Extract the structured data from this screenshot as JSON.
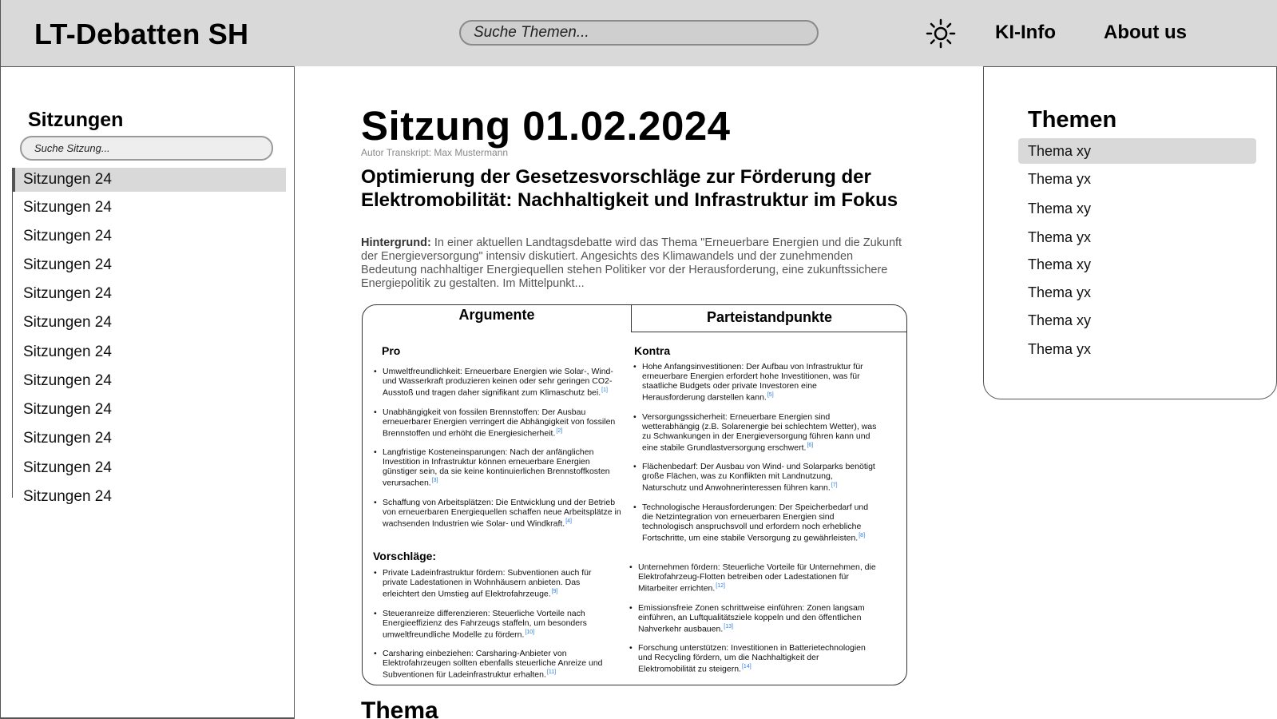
{
  "header": {
    "logo": "LT-Debatten SH",
    "search_placeholder": "Suche Themen...",
    "theme_toggle_icon": "sun-icon",
    "nav": [
      "KI-Info",
      "About us"
    ]
  },
  "left_sidebar": {
    "title": "Sitzungen",
    "search_placeholder": "Suche Sitzung...",
    "items": [
      "Sitzungen 24",
      "Sitzungen 24",
      "Sitzungen 24",
      "Sitzungen 24",
      "Sitzungen 24",
      "Sitzungen 24",
      "Sitzungen 24",
      "Sitzungen 24",
      "Sitzungen 24",
      "Sitzungen 24",
      "Sitzungen 24",
      "Sitzungen 24"
    ],
    "active_index": 0
  },
  "right_sidebar": {
    "title": "Themen",
    "items": [
      "Thema xy",
      "Thema yx",
      "Thema xy",
      "Thema yx",
      "Thema xy",
      "Thema yx",
      "Thema xy",
      "Thema yx"
    ],
    "active_index": 0
  },
  "main": {
    "session_title": "Sitzung 01.02.2024",
    "author": "Autor Transkript: Max Mustermann",
    "debate_title": "Optimierung der Gesetzesvorschläge zur Förderung der Elektromobilität: Nachhaltigkeit und Infrastruktur im Fokus",
    "background_label": "Hintergrund:",
    "background_text": " In einer aktuellen Landtagsdebatte wird das Thema \"Erneuerbare Energien und die Zukunft der Energieversorgung\" intensiv diskutiert. Angesichts des Klimawandels und der zunehmenden Bedeutung nachhaltiger Energiequellen stehen Politiker vor der Herausforderung, eine zukunftssichere Energiepolitik zu gestalten. Im Mittelpunkt...",
    "tabs": [
      "Argumente",
      "Parteistandpunkte"
    ],
    "pro_heading": "Pro",
    "contra_heading": "Kontra",
    "pro": [
      {
        "text": "Umweltfreundlichkeit: Erneuerbare Energien wie Solar-, Wind- und Wasserkraft produzieren keinen oder sehr geringen CO2-Ausstoß und tragen daher signifikant zum Klimaschutz bei.",
        "ref": "[1]"
      },
      {
        "text": "Unabhängigkeit von fossilen Brennstoffen: Der Ausbau erneuerbarer Energien verringert die Abhängigkeit von fossilen Brennstoffen und erhöht die Energiesicherheit.",
        "ref": "[2]"
      },
      {
        "text": "Langfristige Kosteneinsparungen: Nach der anfänglichen Investition in Infrastruktur können erneuerbare Energien günstiger sein, da sie keine kontinuierlichen Brennstoffkosten verursachen.",
        "ref": "[3]"
      },
      {
        "text": "Schaffung von Arbeitsplätzen: Die Entwicklung und der Betrieb von erneuerbaren Energiequellen schaffen neue Arbeitsplätze in wachsenden Industrien wie Solar- und Windkraft.",
        "ref": "[4]"
      }
    ],
    "contra": [
      {
        "text": "Hohe Anfangsinvestitionen: Der Aufbau von Infrastruktur für erneuerbare Energien erfordert hohe Investitionen, was für staatliche Budgets oder private Investoren eine Herausforderung darstellen kann.",
        "ref": "[5]"
      },
      {
        "text": "Versorgungssicherheit: Erneuerbare Energien sind wetterabhängig (z.B. Solarenergie bei schlechtem Wetter), was zu Schwankungen in der Energieversorgung führen kann und eine stabile Grundlastversorgung erschwert.",
        "ref": "[6]"
      },
      {
        "text": "Flächenbedarf: Der Ausbau von Wind- und Solarparks benötigt große Flächen, was zu Konflikten mit Landnutzung, Naturschutz und Anwohnerinteressen führen kann.",
        "ref": "[7]"
      },
      {
        "text": "Technologische Herausforderungen: Der Speicherbedarf und die Netzintegration von erneuerbaren Energien sind technologisch anspruchsvoll und erfordern noch erhebliche Fortschritte, um eine stabile Versorgung zu gewährleisten.",
        "ref": "[8]"
      }
    ],
    "proposals_heading": "Vorschläge:",
    "proposals_left": [
      {
        "text": "Private Ladeinfrastruktur fördern: Subventionen auch für private Ladestationen in Wohnhäusern anbieten. Das erleichtert den Umstieg auf Elektrofahrzeuge.",
        "ref": "[9]"
      },
      {
        "text": "Steueranreize differenzieren: Steuerliche Vorteile nach Energieeffizienz des Fahrzeugs staffeln, um besonders umweltfreundliche Modelle zu fördern.",
        "ref": "[10]"
      },
      {
        "text": "Carsharing einbeziehen: Carsharing-Anbieter von Elektrofahrzeugen sollten ebenfalls steuerliche Anreize und Subventionen für Ladeinfrastruktur erhalten.",
        "ref": "[11]"
      }
    ],
    "proposals_right": [
      {
        "text": "Unternehmen fördern: Steuerliche Vorteile für Unternehmen, die Elektrofahrzeug-Flotten betreiben oder Ladestationen für Mitarbeiter errichten.",
        "ref": "[12]"
      },
      {
        "text": "Emissionsfreie Zonen schrittweise einführen: Zonen langsam einführen, an Luftqualitätsziele koppeln und den öffentlichen Nahverkehr ausbauen.",
        "ref": "[13]"
      },
      {
        "text": "Forschung unterstützen: Investitionen in Batterietechnologien und Recycling fördern, um die Nachhaltigkeit der Elektromobilität zu steigern.",
        "ref": "[14]"
      }
    ],
    "next_heading": "Thema"
  }
}
